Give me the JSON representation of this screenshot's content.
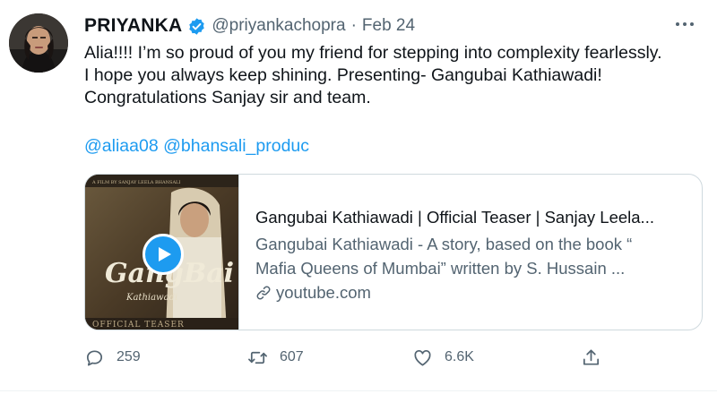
{
  "tweet": {
    "author": {
      "display_name": "PRIYANKA",
      "handle": "@priyankachopra",
      "verified": true,
      "separator": "·",
      "date": "Feb 24"
    },
    "text_lines": [
      "Alia!!!! I’m so proud of you my friend for stepping into complexity fearlessly.",
      "I hope you always keep shining. Presenting- Gangubai Kathiawadi!",
      "Congratulations Sanjay sir and team."
    ],
    "mentions": [
      "@aliaa08",
      "@bhansali_produc"
    ],
    "card": {
      "title": "Gangubai Kathiawadi | Official Teaser | Sanjay Leela...",
      "description_lines": [
        "Gangubai Kathiawadi - A story, based on the book “",
        "Mafia Queens of Mumbai” written by S. Hussain ..."
      ],
      "domain": "youtube.com",
      "thumbnail": {
        "logo_text": "GangBai",
        "logo_subtext": "Kathiawadi",
        "caption": "OFFICIAL TEASER",
        "top_text": "A FILM BY SANJAY LEELA BHANSALI"
      }
    },
    "actions": {
      "replies": "259",
      "retweets": "607",
      "likes": "6.6K"
    }
  },
  "colors": {
    "accent": "#1d9bf0",
    "muted": "#536471",
    "border": "#cfd9de"
  }
}
